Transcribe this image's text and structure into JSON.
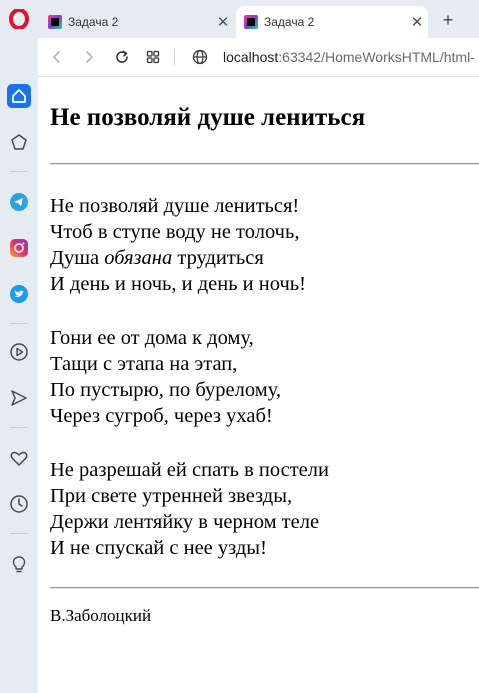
{
  "browser": {
    "tabs": [
      {
        "title": "Задача 2",
        "active": false
      },
      {
        "title": "Задача 2",
        "active": true
      }
    ],
    "url_host": "localhost",
    "url_rest": ":63342/HomeWorksHTML/html-",
    "sidebar_icons": [
      "opera-logo-icon",
      "home-icon",
      "cube-icon",
      "telegram-icon",
      "instagram-icon",
      "twitter-icon",
      "play-icon",
      "send-icon",
      "heart-icon",
      "clock-icon",
      "lightbulb-icon"
    ]
  },
  "page": {
    "heading": "Не позволяй душе лениться",
    "stanza1": {
      "line1": "Не позволяй душе лениться!",
      "line2": "Чтоб в ступе воду не толочь,",
      "line3_start": "Душа ",
      "line3_em": "обязана",
      "line3_end": " трудиться",
      "line4": "И день и ночь, и день и ночь!"
    },
    "stanza2": [
      "Гони ее от дома к дому,",
      "Тащи с этапа на этап,",
      "По пустырю, по бурелому,",
      "Через сугроб, через ухаб!"
    ],
    "stanza3": [
      "Не разрешай ей спать в постели",
      "При свете утренней звезды,",
      "Держи лентяйку в черном теле",
      "И не спускай с нее узды!"
    ],
    "author": "В.Заболоцкий"
  }
}
